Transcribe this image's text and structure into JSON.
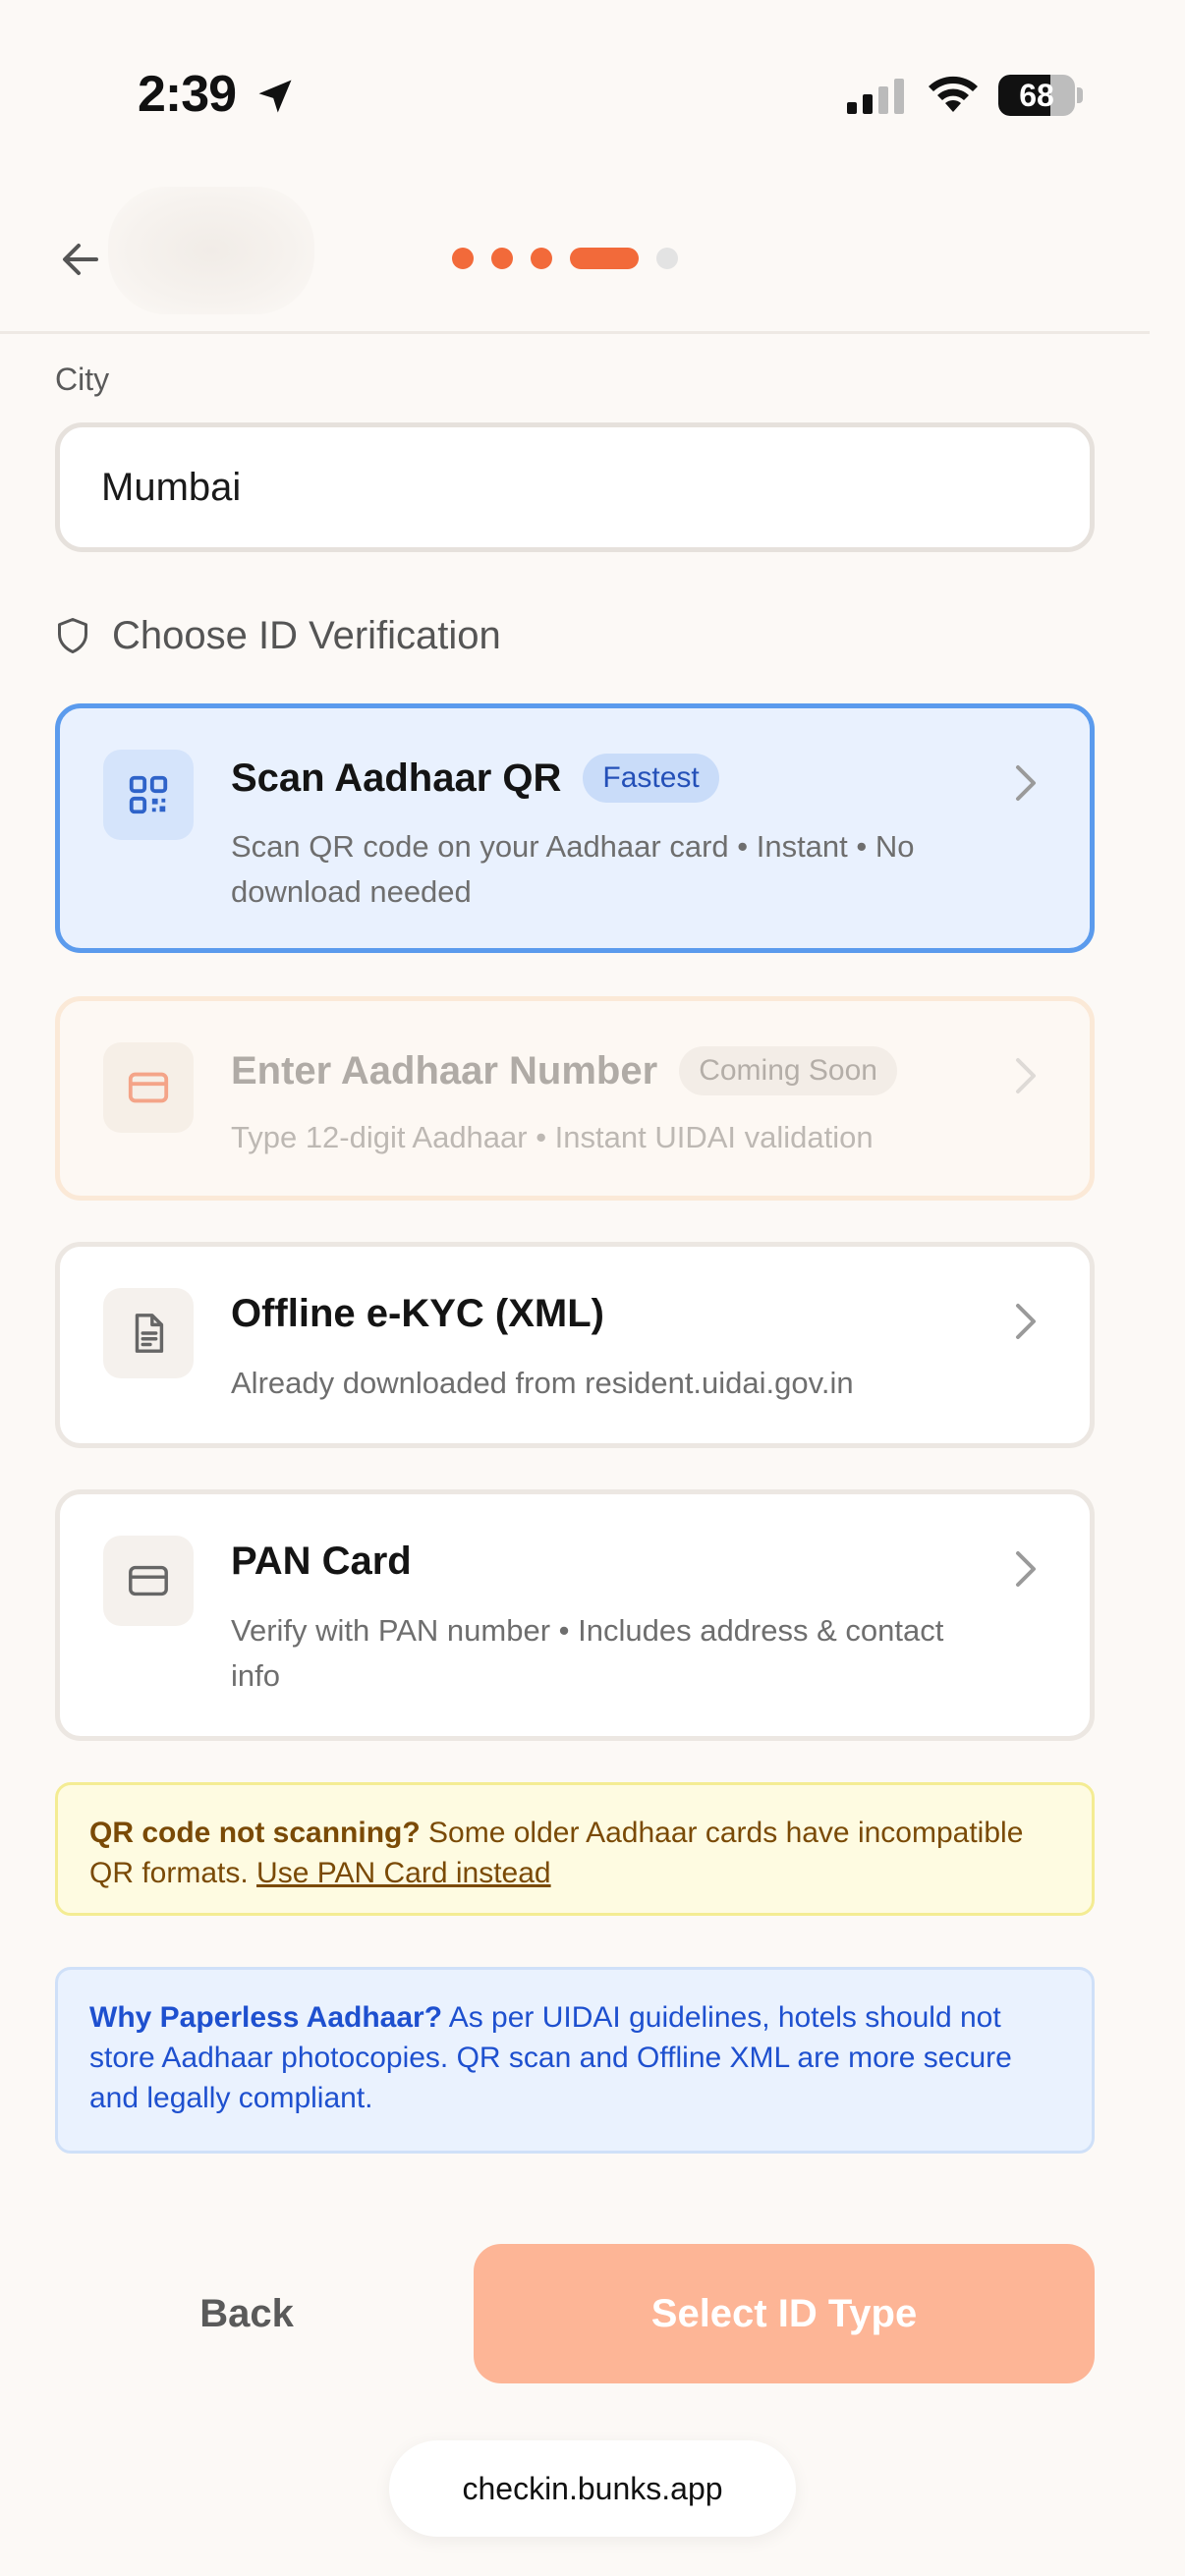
{
  "status_bar": {
    "time": "2:39",
    "battery": "68",
    "battery_level": 0.68
  },
  "header": {
    "steps_total": 5,
    "steps_done": 3,
    "step_current": 4
  },
  "form": {
    "city_label": "City",
    "city_value": "Mumbai"
  },
  "verification": {
    "section_title": "Choose ID Verification",
    "options": [
      {
        "title": "Scan Aadhaar QR",
        "badge": "Fastest",
        "desc": "Scan QR code on your Aadhaar card • Instant • No download needed",
        "state": "selected",
        "icon": "qr-code-icon"
      },
      {
        "title": "Enter Aadhaar Number",
        "badge": "Coming Soon",
        "desc": "Type 12-digit Aadhaar • Instant UIDAI validation",
        "state": "disabled",
        "icon": "card-icon"
      },
      {
        "title": "Offline e-KYC (XML)",
        "desc": "Already downloaded from resident.uidai.gov.in",
        "state": "default",
        "icon": "document-icon"
      },
      {
        "title": "PAN Card",
        "desc": "Verify with PAN number • Includes address & contact info",
        "state": "default",
        "icon": "card-icon"
      }
    ]
  },
  "notices": {
    "qr_warning_bold": "QR code not scanning?",
    "qr_warning_text": " Some older Aadhaar cards have incompatible QR formats. ",
    "qr_warning_link": "Use PAN Card instead",
    "paperless_bold": "Why Paperless Aadhaar?",
    "paperless_text": " As per UIDAI guidelines, hotels should not store Aadhaar photocopies. QR scan and Offline XML are more secure and legally compliant."
  },
  "actions": {
    "back_label": "Back",
    "primary_label": "Select ID Type"
  },
  "browser": {
    "url": "checkin.bunks.app"
  },
  "colors": {
    "accent": "#f26a3a",
    "selected_border": "#5b9bed",
    "primary_disabled": "#fdb596"
  }
}
